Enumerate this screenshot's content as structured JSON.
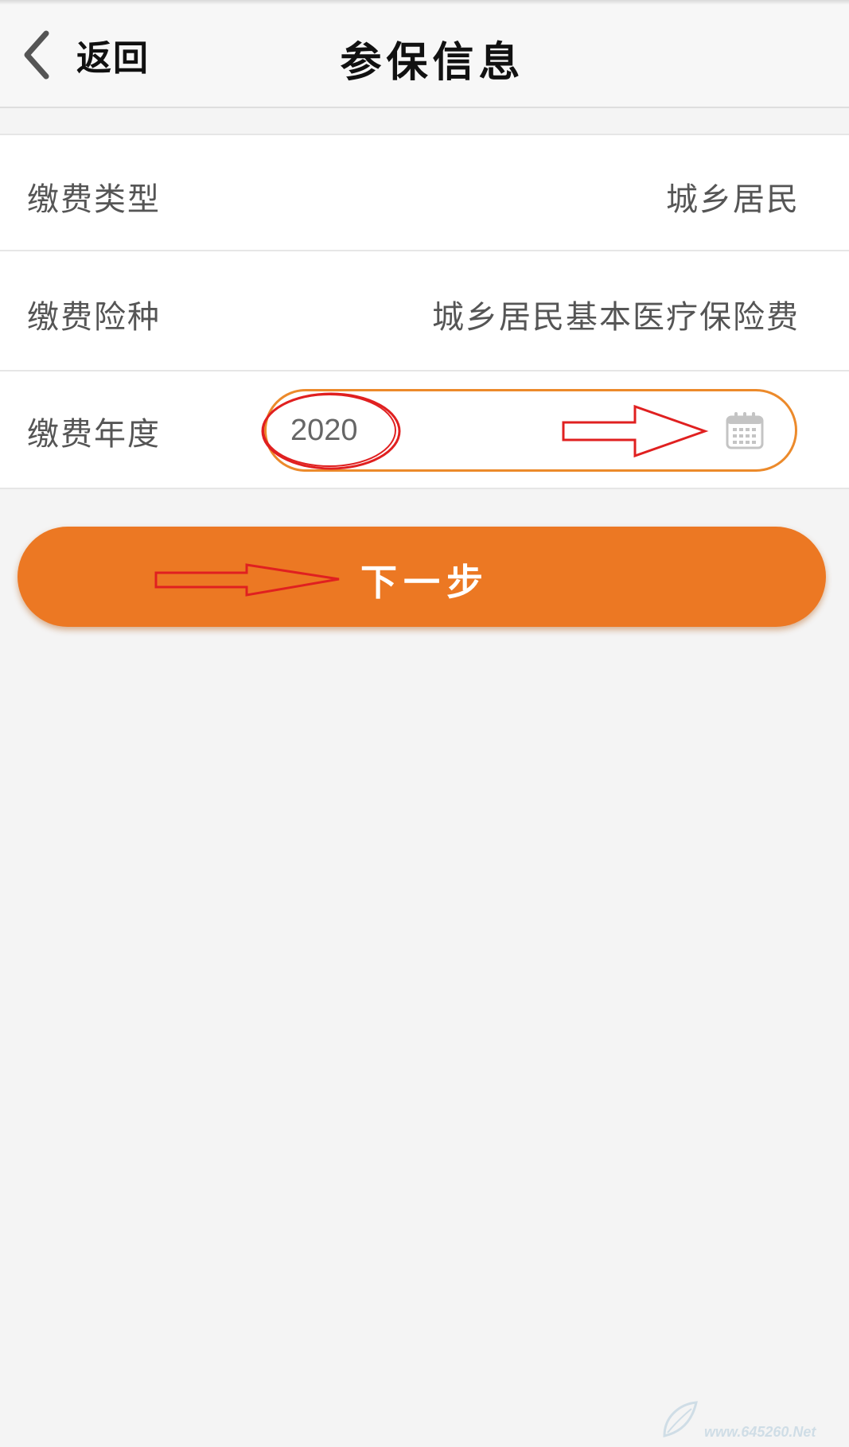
{
  "header": {
    "back_label": "返回",
    "title": "参保信息"
  },
  "form": {
    "rows": [
      {
        "label": "缴费类型",
        "value": "城乡居民"
      },
      {
        "label": "缴费险种",
        "value": "城乡居民基本医疗保险费"
      },
      {
        "label": "缴费年度",
        "value": "2020"
      }
    ]
  },
  "actions": {
    "next_label": "下一步"
  },
  "watermark": {
    "text": "www.645260.Net"
  },
  "colors": {
    "accent": "#ec7823",
    "field_border": "#ec8a2b",
    "annotation": "#e02020"
  },
  "icons": {
    "back": "chevron-left-icon",
    "calendar": "calendar-icon"
  }
}
